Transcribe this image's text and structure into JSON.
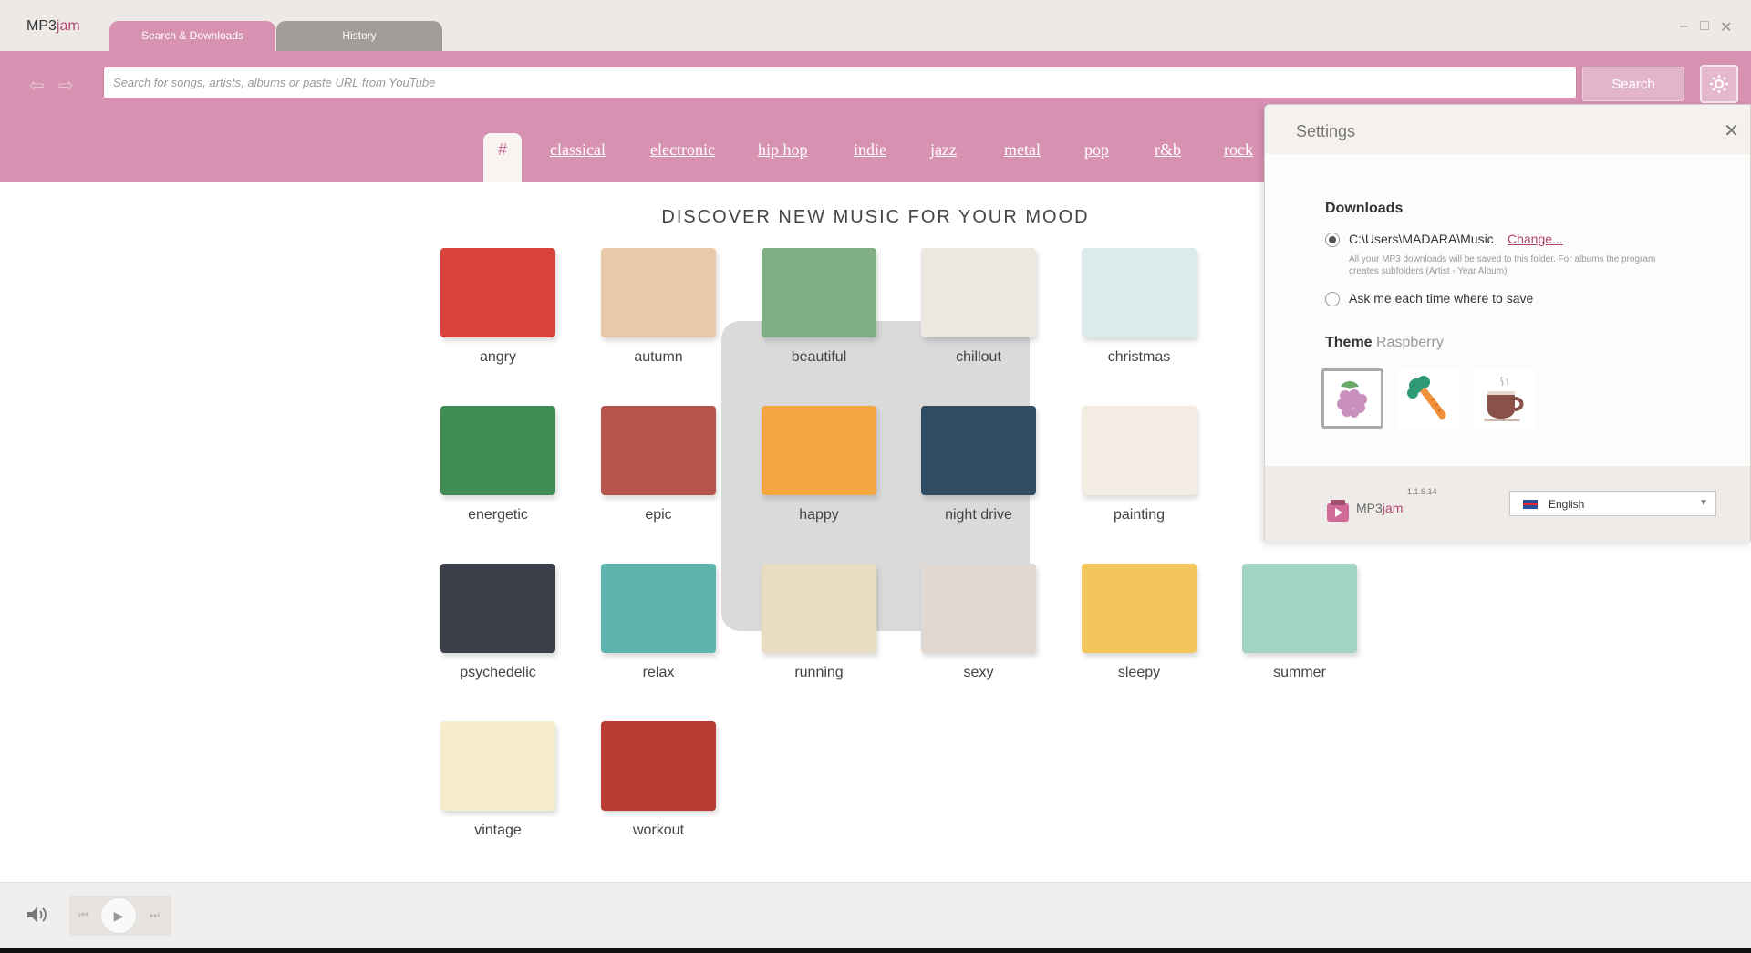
{
  "app": {
    "logo_a": "MP3",
    "logo_b": "jam"
  },
  "tabs": [
    {
      "label": "Search & Downloads"
    },
    {
      "label": "History"
    }
  ],
  "window_controls": {
    "minimize": "–",
    "maximize": "□",
    "close": "✕"
  },
  "search": {
    "placeholder": "Search for songs, artists, albums or paste URL from YouTube",
    "value": "",
    "button_label": "Search"
  },
  "genres": {
    "hash": "#",
    "items": [
      "classical",
      "electronic",
      "hip hop",
      "indie",
      "jazz",
      "metal",
      "pop",
      "r&b",
      "rock"
    ]
  },
  "main": {
    "title": "DISCOVER NEW MUSIC FOR YOUR MOOD",
    "moods": [
      {
        "label": "angry",
        "color": "#d9443a"
      },
      {
        "label": "autumn",
        "color": "#e8c9a8"
      },
      {
        "label": "beautiful",
        "color": "#7fae84"
      },
      {
        "label": "chillout",
        "color": "#ece8df"
      },
      {
        "label": "christmas",
        "color": "#dcebea"
      },
      {
        "label": "energetic",
        "color": "#3f8d55"
      },
      {
        "label": "epic",
        "color": "#b8544e"
      },
      {
        "label": "happy",
        "color": "#f4a642"
      },
      {
        "label": "night drive",
        "color": "#2f4c63"
      },
      {
        "label": "painting",
        "color": "#f3ece3"
      },
      {
        "label": "psychedelic",
        "color": "#3a3f4a"
      },
      {
        "label": "relax",
        "color": "#5fb5ad"
      },
      {
        "label": "running",
        "color": "#e8dcc3"
      },
      {
        "label": "sexy",
        "color": "#e2d8d2"
      },
      {
        "label": "sleepy",
        "color": "#f2c65a"
      },
      {
        "label": "summer",
        "color": "#a3d4c3"
      },
      {
        "label": "vintage",
        "color": "#f6eccb"
      },
      {
        "label": "workout",
        "color": "#b93b33"
      }
    ]
  },
  "settings": {
    "title": "Settings",
    "downloads_heading": "Downloads",
    "download_path": "C:\\Users\\MADARA\\Music",
    "change_label": "Change...",
    "note": "All your MP3 downloads will be saved to this folder. For albums the program creates subfolders (Artist - Year Album)",
    "ask_label": "Ask me each time where to save",
    "theme_heading": "Theme",
    "theme_name": "Raspberry",
    "themes": [
      "raspberry-icon",
      "carrot-icon",
      "coffee-icon"
    ],
    "version": "1.1.6.14",
    "footer_brand_a": "MP3",
    "footer_brand_b": "jam",
    "language": "English"
  },
  "colors": {
    "accent": "#d792b2",
    "brand": "#b0476e"
  }
}
